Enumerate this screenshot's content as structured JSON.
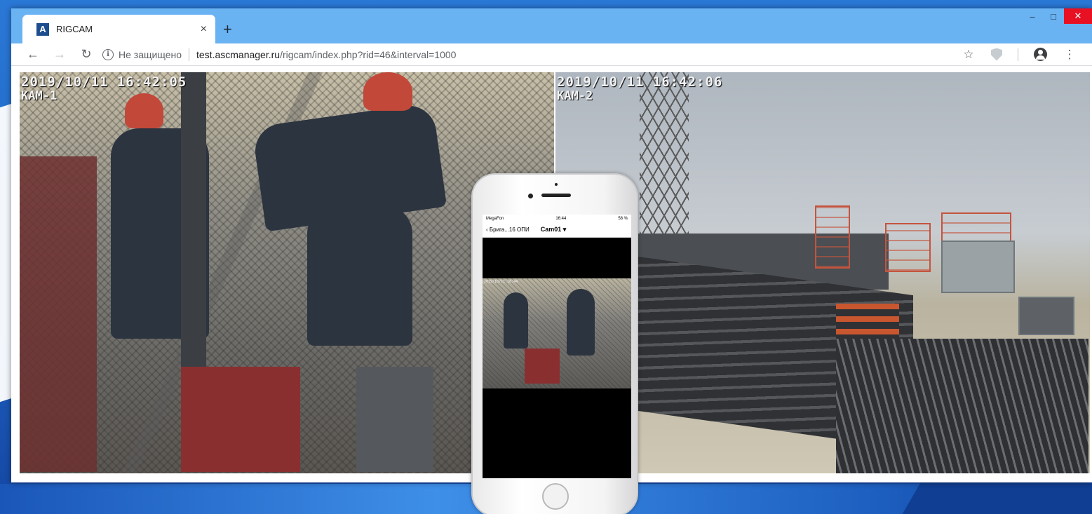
{
  "browser": {
    "tab_title": "RIGCAM",
    "tab_close": "×",
    "new_tab": "+",
    "window_minimize": "–",
    "window_maximize": "□",
    "window_close": "✕",
    "security_label": "Не защищено",
    "url_host": "test.ascmanager.ru",
    "url_path": "/rigcam/index.php?rid=46&interval=1000",
    "favicon_letter": "A"
  },
  "cameras": [
    {
      "timestamp": "2019/10/11 16:42:05",
      "label": "КАМ-1"
    },
    {
      "timestamp": "2019/10/11 16:42:06",
      "label": "КАМ-2"
    }
  ],
  "phone": {
    "carrier": "MegaFon",
    "time": "16:44",
    "battery": "58 %",
    "back_label": "Брига...16 ОПИ",
    "camera_selector": "Cam01 ▾",
    "video_timestamp": "2019/10/11 16:44"
  },
  "icons": {
    "back": "arrow-left-icon",
    "forward": "arrow-right-icon",
    "reload": "reload-icon",
    "info": "info-icon",
    "bookmark": "star-icon",
    "extension": "shield-icon",
    "account": "account-icon",
    "menu": "more-vert-icon"
  }
}
